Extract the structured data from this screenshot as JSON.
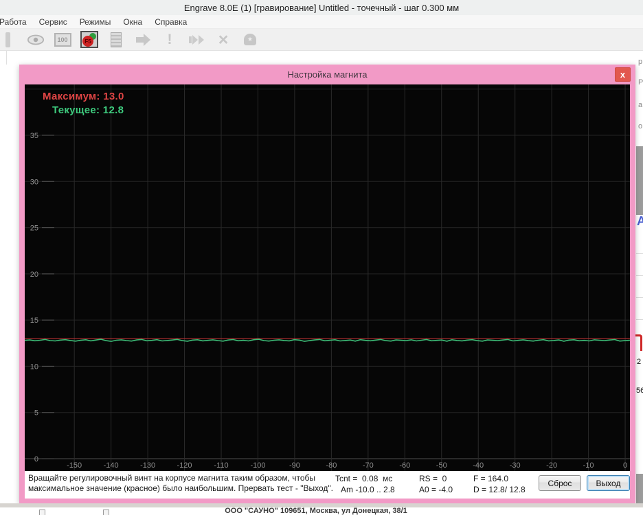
{
  "window": {
    "title": "Engrave 8.0E (1) [гравирование] Untitled - точечный - шаг 0.300 мм",
    "menu": [
      "Работа",
      "Сервис",
      "Режимы",
      "Окна",
      "Справка"
    ],
    "toolbar": {
      "zoom_label": "100",
      "f5_label": "F5",
      "exclamation_glyph": "!",
      "cancel_glyph": "×",
      "bell_glyph": "★",
      "icons": [
        "partial-icon",
        "eye-icon",
        "zoom-100-icon",
        "engrave-f5-icon",
        "document-icon",
        "arrow-right-icon",
        "exclamation-icon",
        "fast-forward-icon",
        "cancel-x-icon",
        "bell-icon"
      ]
    }
  },
  "dialog": {
    "title": "Настройка магнита",
    "close_glyph": "x",
    "overlay": {
      "max_label": "Максимум: 13.0",
      "cur_label": "Текущее: 12.8"
    },
    "footer": {
      "instruction_line1": "Вращайте регулировочный винт на корпусе магнита таким образом, чтобы",
      "instruction_line2": "максимальное значение (красное) было наибольшим. Прервать тест - \"Выход\".",
      "stats": [
        {
          "l1": "Tcnt =  0.08  мс",
          "l2": "Am -10.0 .. 2.8"
        },
        {
          "l1": "RS =  0",
          "l2": "A0 = -4.0"
        },
        {
          "l1": "F = 164.0",
          "l2": "D = 12.8/ 12.8"
        }
      ],
      "reset_button": "Сброс",
      "exit_button": "Выход"
    }
  },
  "chart_data": {
    "type": "line",
    "title": "",
    "xlabel": "",
    "ylabel": "",
    "grid": true,
    "xlim": [
      -163.5,
      1.3
    ],
    "ylim": [
      -1.34,
      40.5
    ],
    "x_ticks": [
      -150,
      -140,
      -130,
      -120,
      -110,
      -100,
      -90,
      -80,
      -70,
      -60,
      -50,
      -40,
      -30,
      -20,
      -10,
      0
    ],
    "y_ticks": [
      0,
      5,
      10,
      15,
      20,
      25,
      30,
      35
    ],
    "series": [
      {
        "name": "Максимум",
        "type": "hline",
        "value": 13.0,
        "color": "#b83232"
      },
      {
        "name": "Текущее",
        "type": "samples",
        "color": "#3dbd78",
        "x_start": -163.5,
        "x_end": 1.3,
        "values": [
          12.8,
          12.85,
          12.76,
          12.82,
          12.9,
          12.78,
          12.74,
          12.83,
          12.88,
          12.79,
          12.72,
          12.81,
          12.87,
          12.75,
          12.84,
          12.92,
          12.77,
          12.7,
          12.82,
          12.86,
          12.78,
          12.73,
          12.85,
          12.9,
          12.76,
          12.8,
          12.88,
          12.74,
          12.79,
          12.84,
          12.91,
          12.77,
          12.71,
          12.83,
          12.87,
          12.75,
          12.8,
          12.86,
          12.78,
          12.72,
          12.84,
          12.89,
          12.76,
          12.81,
          12.74,
          12.87,
          12.92,
          12.78,
          12.73,
          12.82,
          12.86,
          12.79,
          12.75,
          12.88,
          12.83,
          12.7,
          12.77,
          12.85,
          12.9,
          12.76,
          12.81,
          12.87,
          12.74,
          12.79,
          12.84,
          12.72,
          12.88,
          12.8,
          12.76,
          12.83,
          12.9,
          12.77,
          12.73,
          12.85,
          12.81,
          12.78,
          12.86,
          12.74,
          12.82,
          12.89,
          12.76,
          12.8,
          12.84,
          12.71,
          12.87,
          12.79,
          12.75,
          12.83,
          12.88,
          12.77,
          12.72,
          12.85,
          12.81,
          12.78,
          12.84,
          12.9,
          12.74,
          12.8,
          12.86,
          12.77,
          12.73,
          12.82,
          12.88,
          12.75,
          12.79,
          12.85,
          12.71,
          12.83,
          12.87,
          12.76,
          12.8,
          12.74,
          12.86,
          12.82,
          12.78,
          12.84,
          12.89,
          12.73,
          12.77,
          12.81
        ]
      }
    ],
    "annotations": [
      "Максимум: 13.0",
      "Текущее: 12.8"
    ],
    "legend_position": "none"
  },
  "background": {
    "right_edge_fragments": [
      "р",
      "Р",
      "а",
      "о"
    ],
    "right_edge_letter": "А",
    "right_edge_num1": "2",
    "right_edge_num2": "56",
    "bottom_text": "ООО \"САУНО\" 109651, Москва, ул Донецкая, 38/1"
  },
  "colors": {
    "dialog_pink": "#f29ac6",
    "close_red": "#e2574e",
    "max_red": "#e04545",
    "cur_green": "#3ecb7e",
    "plot_bg": "#060606",
    "grid": "#262626"
  }
}
